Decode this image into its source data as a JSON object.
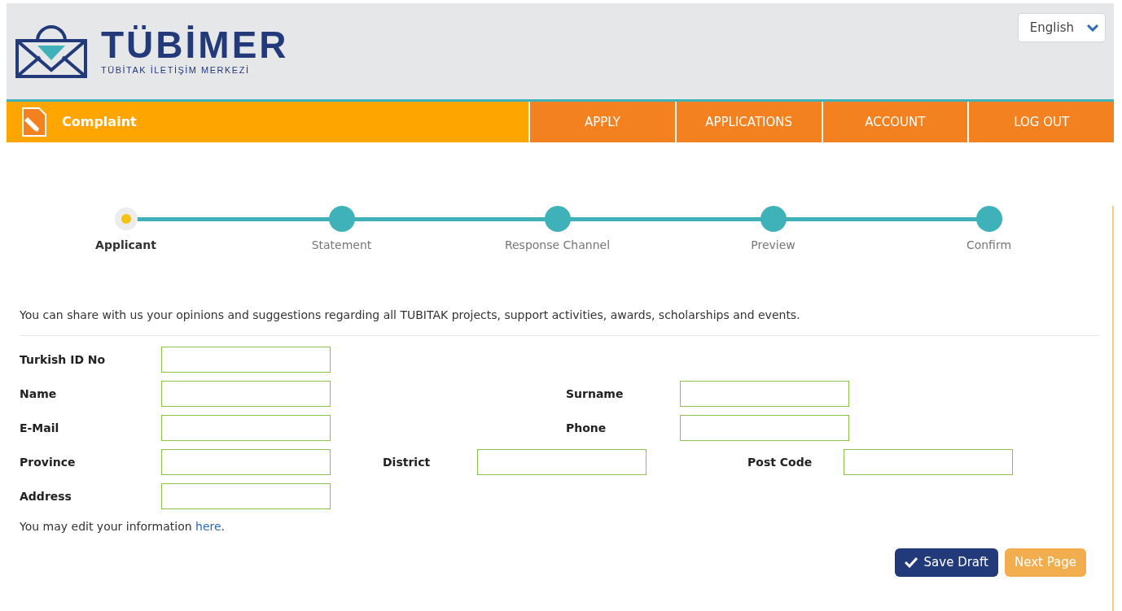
{
  "header": {
    "logo_title": "TÜBİMER",
    "logo_subtitle": "TÜBİTAK İLETİŞİM MERKEZİ",
    "language": "English"
  },
  "nav": {
    "section": "Complaint",
    "items": [
      {
        "label": "APPLY"
      },
      {
        "label": "APPLICATIONS"
      },
      {
        "label": "ACCOUNT"
      },
      {
        "label": "LOG OUT"
      }
    ]
  },
  "steps": [
    {
      "label": "Applicant",
      "selected": true
    },
    {
      "label": "Statement",
      "selected": false
    },
    {
      "label": "Response Channel",
      "selected": false
    },
    {
      "label": "Preview",
      "selected": false
    },
    {
      "label": "Confirm",
      "selected": false
    }
  ],
  "intro": "You can share with us your opinions and suggestions regarding all TUBITAK projects, support activities, awards, scholarships and events.",
  "form_rows": [
    [
      {
        "label": "Turkish ID No"
      }
    ],
    [
      {
        "label": "Name"
      },
      {
        "label": "Surname"
      }
    ],
    [
      {
        "label": "E-Mail"
      },
      {
        "label": "Phone"
      }
    ],
    [
      {
        "label": "Province"
      },
      {
        "label": "District"
      },
      {
        "label": "Post Code"
      }
    ],
    [
      {
        "label": "Address"
      }
    ]
  ],
  "edit_note": {
    "text": "You may edit your information",
    "link": "here",
    "end": "."
  },
  "buttons": [
    {
      "label": "Save Draft",
      "kind": "primary"
    },
    {
      "label": "Next Page",
      "kind": "secondary"
    }
  ]
}
